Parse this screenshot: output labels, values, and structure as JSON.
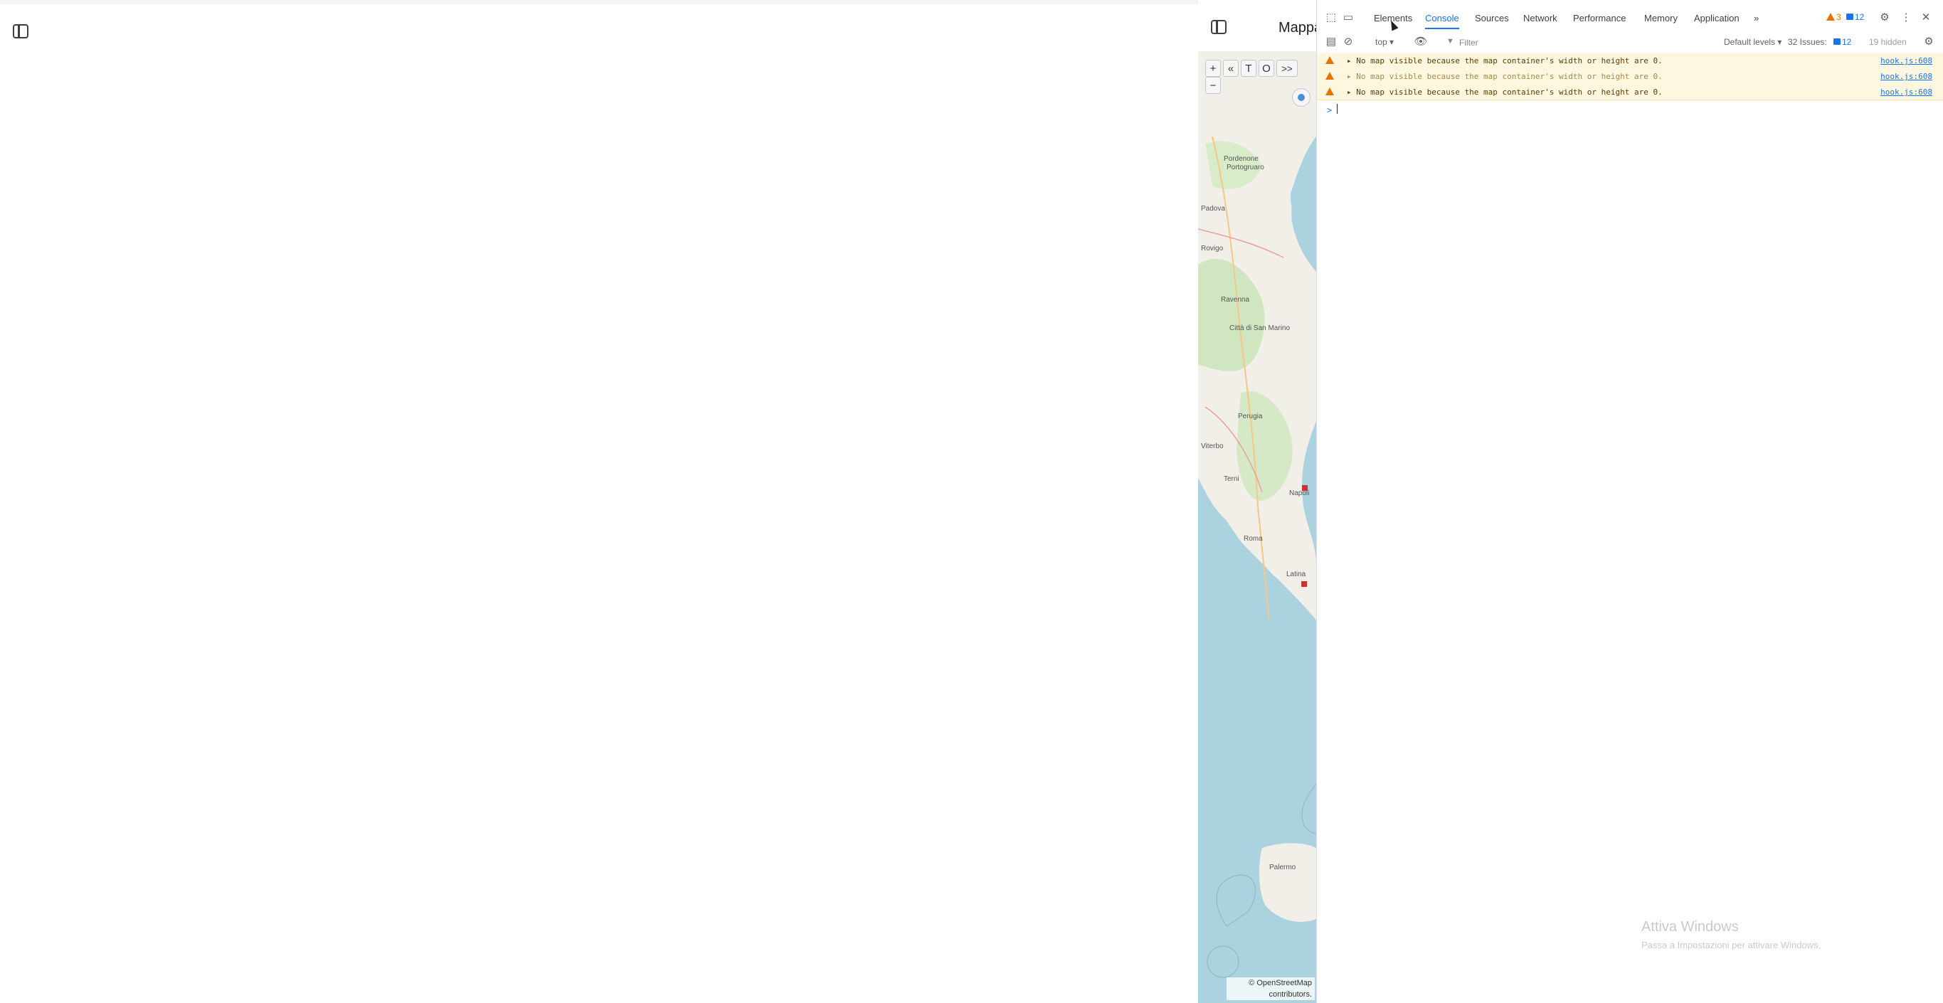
{
  "app": {
    "heading": "Mappa"
  },
  "map": {
    "toolbar": [
      "+",
      "«",
      "T",
      "O",
      ">>"
    ],
    "zoom_out": "−",
    "attribution": "© OpenStreetMap contributors.",
    "labels": [
      "Pordenone",
      "Portogruaro",
      "Padova",
      "Rovigo",
      "Ravenna",
      "Città di San Marino",
      "Perugia",
      "Terni",
      "Roma",
      "Latina",
      "Viterbo",
      "Napoli",
      "Palermo"
    ]
  },
  "devtools": {
    "tabs": [
      "Elements",
      "Console",
      "Sources",
      "Network",
      "Performance",
      "Memory",
      "Application",
      "»"
    ],
    "active_tab": "Console",
    "warning_count": "3",
    "message_count": "12",
    "toolbar": {
      "context": "top ▾",
      "filter_placeholder": "Filter",
      "levels": "Default levels ▾",
      "issues": "32 Issues:",
      "issues_count": "12",
      "hidden": "19 hidden"
    },
    "console": [
      {
        "message": "▸ No map visible because the map container's width or height are 0.",
        "source": "hook.js:608"
      },
      {
        "message": "▸ No map visible because the map container's width or height are 0.",
        "source": "hook.js:608"
      },
      {
        "message": "▸ No map visible because the map container's width or height are 0.",
        "source": "hook.js:608"
      }
    ],
    "prompt": ">"
  },
  "watermark": {
    "title": "Attiva Windows",
    "subtitle": "Passa a Impostazioni per attivare Windows."
  },
  "colors": {
    "accent": "#1a73e8",
    "warning": "#e37400",
    "warning_bg": "#fef7e0",
    "sea": "#aad3df",
    "land": "#f2efe9"
  }
}
